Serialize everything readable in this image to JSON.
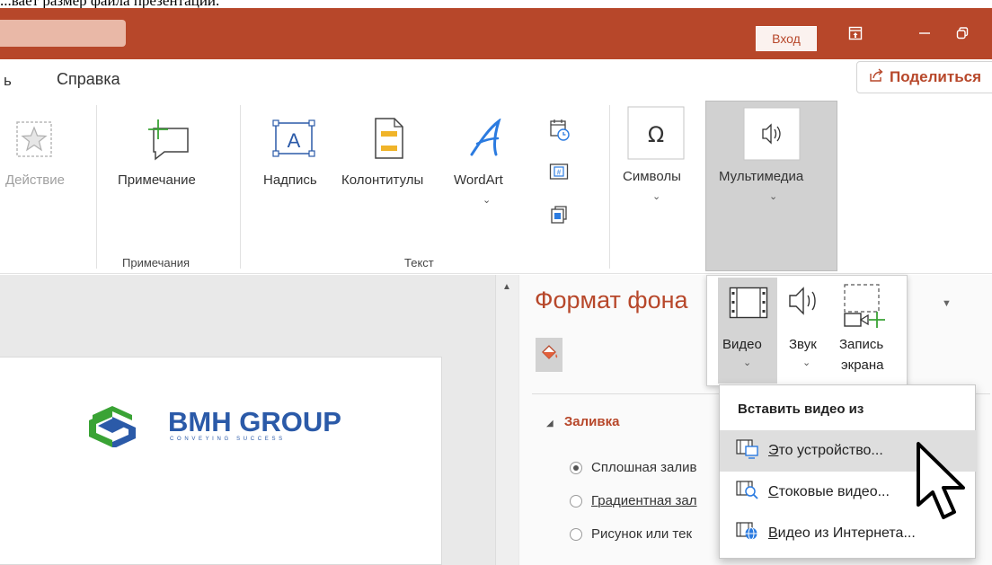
{
  "caption": "...вает размер файла презентации.",
  "title_bar": {
    "sign_in": "Вход",
    "controls": [
      "ribbon-display-icon",
      "minimize-icon",
      "restore-icon"
    ]
  },
  "tabs": {
    "partial_tab": "ь",
    "help": "Справка",
    "share": "Поделиться"
  },
  "ribbon": {
    "action": "Действие",
    "comment": "Примечание",
    "comments_group": "Примечания",
    "textbox": "Надпись",
    "header_footer": "Колонтитулы",
    "wordart": "WordArt",
    "text_group": "Текст",
    "symbols": "Символы",
    "media": "Мультимедиа"
  },
  "media_popup": {
    "video": "Видео",
    "audio": "Звук",
    "screen_recording_line1": "Запись",
    "screen_recording_line2": "экрана"
  },
  "insert_video_menu": {
    "header": "Вставить видео из",
    "items": [
      {
        "prefix": "",
        "key": "Э",
        "rest": "то устройство...",
        "highlighted": true
      },
      {
        "prefix": "",
        "key": "С",
        "rest": "токовые видео...",
        "highlighted": false
      },
      {
        "prefix": "",
        "key": "В",
        "rest": "идео из Интернета...",
        "highlighted": false
      }
    ]
  },
  "format_pane": {
    "title": "Формат фона",
    "section": "Заливка",
    "options": [
      {
        "text": "Сплошная залив",
        "selected": true
      },
      {
        "text": "Градиентная зал",
        "selected": false
      },
      {
        "text": "Рисунок или тек",
        "selected": false
      }
    ]
  },
  "slide": {
    "logo_text": "BMH GROUP",
    "logo_tagline": "C O N V E Y I N G   S U C C E S S"
  },
  "colors": {
    "accent": "#b7472a",
    "logo_blue": "#2b5aa8",
    "logo_green": "#3aa335"
  }
}
